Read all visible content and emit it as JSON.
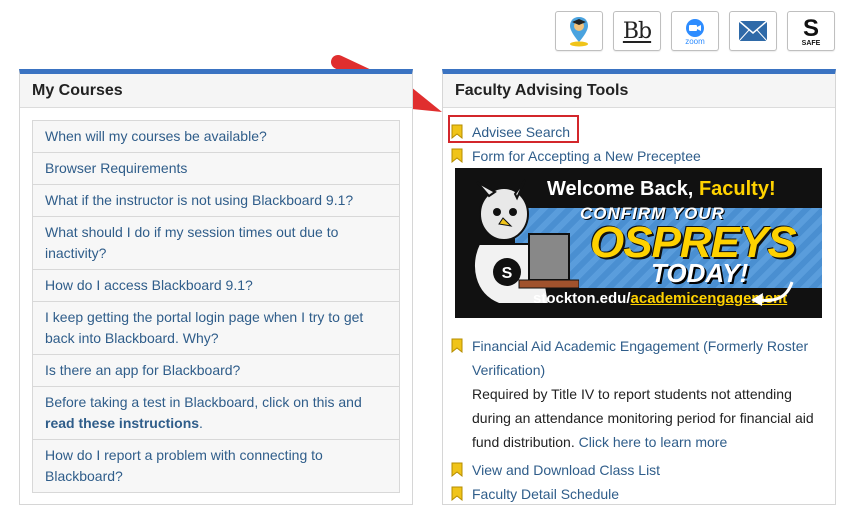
{
  "topbar": {
    "icons": [
      {
        "name": "graduate-map-pin-icon"
      },
      {
        "name": "blackboard-icon",
        "label": "Bb"
      },
      {
        "name": "zoom-icon",
        "label": "zoom"
      },
      {
        "name": "mail-icon"
      },
      {
        "name": "safe-icon",
        "label": "SAFE"
      }
    ]
  },
  "colors": {
    "accent": "#3a73c2",
    "link": "#2f5d8a",
    "highlight": "#d3262b",
    "bookmark": "#f0c419"
  },
  "my_courses": {
    "title": "My Courses",
    "items": [
      {
        "text": "When will my courses be available?"
      },
      {
        "text": "Browser Requirements"
      },
      {
        "text": "What if the instructor is not using Blackboard 9.1?"
      },
      {
        "text": "What should I do if my session times out due to inactivity?"
      },
      {
        "text": "How do I access Blackboard 9.1?"
      },
      {
        "text": "I keep getting the portal login page when I try to get back into Blackboard. Why?"
      },
      {
        "text": "Is there an app for Blackboard?"
      },
      {
        "text": "Before taking a test in Blackboard, click on this and ",
        "bold": "read these instructions",
        "suffix": "."
      },
      {
        "text": "How do I report a problem with connecting to Blackboard?"
      }
    ]
  },
  "advising": {
    "title": "Faculty Advising Tools",
    "links": {
      "advisee_search": "Advisee Search",
      "preceptee_form": "Form for Accepting a New Preceptee",
      "financial_aid": "Financial Aid Academic Engagement (Formerly Roster Verification)",
      "financial_aid_desc": "Required by Title IV to report students not attending during an attendance monitoring period for financial aid fund distribution.",
      "learn_more": "Click here to learn more",
      "class_list": "View and Download Class List",
      "faculty_schedule": "Faculty Detail Schedule"
    },
    "banner": {
      "welcome": "Welcome Back, ",
      "faculty": "Faculty!",
      "confirm": "CONFIRM YOUR",
      "ospreys": "OSPREYS",
      "today": "TODAY!",
      "url_prefix": "stockton.edu/",
      "url_path": "academicengagement"
    }
  }
}
